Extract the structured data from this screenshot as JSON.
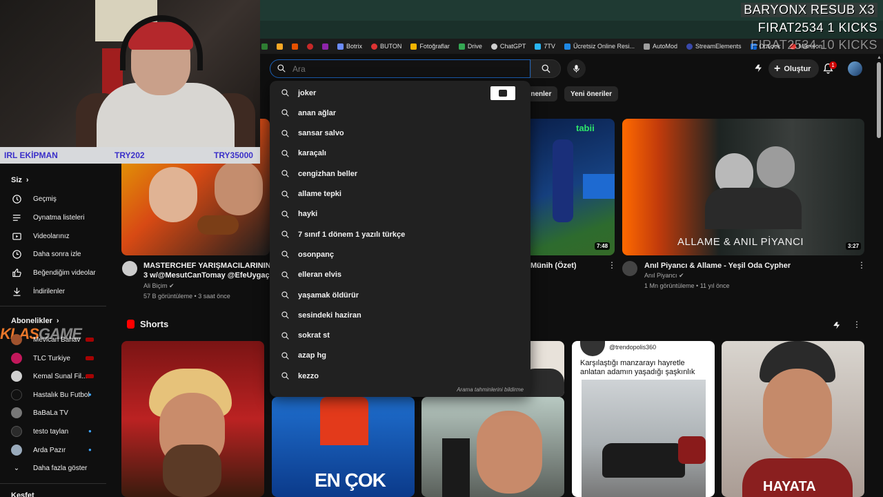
{
  "overlay": {
    "line1": "BARYONX  RESUB X3",
    "line2": "FIRAT2534  1 KICKS",
    "line3": "FIRAT2534  10 KICKS",
    "irl_bar": {
      "left": "IRL EKİPMAN",
      "mid": "TRY202",
      "right": "TRY35000"
    },
    "logo_text": "KLAS",
    "logo_text2": "GAME"
  },
  "bookmarks": [
    {
      "label": "Botrix",
      "color": "#6b8cff"
    },
    {
      "label": "BUTON",
      "color": "#d33"
    },
    {
      "label": "Fotoğraflar",
      "color": "#f4b400"
    },
    {
      "label": "Drive",
      "color": "#34a853"
    },
    {
      "label": "ChatGPT",
      "color": "#cfcfcf"
    },
    {
      "label": "7TV",
      "color": "#29b6f6"
    },
    {
      "label": "Ücretsiz Online Resi...",
      "color": "#1e88e5"
    },
    {
      "label": "AutoMod",
      "color": "#9e9e9e"
    },
    {
      "label": "StreamElements",
      "color": "#3949ab"
    },
    {
      "label": "Outlook",
      "color": "#0a64d6"
    },
    {
      "label": "Mikrofon",
      "color": "#e53935"
    }
  ],
  "search": {
    "placeholder": "Ara",
    "value": ""
  },
  "header": {
    "create_label": "Oluştur",
    "notif_count": "1"
  },
  "chips": [
    "lenenler",
    "Yeni öneriler"
  ],
  "sidebar": {
    "you_label": "Siz",
    "items": [
      {
        "label": "Geçmiş",
        "icon": "history-icon"
      },
      {
        "label": "Oynatma listeleri",
        "icon": "playlist-icon"
      },
      {
        "label": "Videolarınız",
        "icon": "your-videos-icon"
      },
      {
        "label": "Daha sonra izle",
        "icon": "watch-later-icon"
      },
      {
        "label": "Beğendiğim videolar",
        "icon": "like-icon"
      },
      {
        "label": "İndirilenler",
        "icon": "download-icon"
      }
    ],
    "subs_title": "Abonelikler",
    "subs": [
      {
        "label": "Mevlcan Bahav",
        "color": "#a0522d",
        "badge": "live"
      },
      {
        "label": "TLC Turkiye",
        "color": "#c2185b",
        "badge": "live"
      },
      {
        "label": "Kemal Sunal Fil...",
        "color": "#d0d0d0",
        "badge": "live"
      },
      {
        "label": "Hastalık Bu Futbol",
        "color": "#111",
        "badge": "dot"
      },
      {
        "label": "BaBaLa TV",
        "color": "#777",
        "badge": ""
      },
      {
        "label": "testo taylan",
        "color": "#2b2b2b",
        "badge": "dot"
      },
      {
        "label": "Arda Pazır",
        "color": "#9ab",
        "badge": "dot"
      }
    ],
    "show_more": "Daha fazla göster",
    "keşfet": "Keşfet"
  },
  "videos": [
    {
      "title1": "MASTERCHEF YARIŞMACILARININ RE",
      "title2": "3 w/@MesutCanTomay @EfeUygaçYou",
      "channel": "Ali Biçim",
      "meta": "57 B görüntüleme • 3 saat önce"
    },
    {
      "title1": "Münih (Özet)",
      "channel": "",
      "meta": "",
      "duration": "7:48",
      "badge": "tabii"
    },
    {
      "title1": "Anıl Piyancı & Allame - Yeşil Oda Cypher",
      "channel": "Anıl Piyancı",
      "meta": "1 Mn görüntüleme • 11 yıl önce",
      "duration": "3:27",
      "thumb_text": "ALLAME & ANIL PİYANCI"
    }
  ],
  "shorts": {
    "title": "Shorts",
    "card3_handle": "@trendopolis360",
    "card3_caption": "Karşılaştığı manzarayı hayretle anlatan adamın yaşadığı şaşkınlık",
    "card2_caption": "EN ÇOK",
    "card4_caption": "HAYATA"
  },
  "suggestions": [
    "joker",
    "anan ağlar",
    "sansar salvo",
    "karaçalı",
    "cengizhan beller",
    "allame tepki",
    "hayki",
    "7 sınıf 1 dönem 1 yazılı türkçe",
    "osonpanç",
    "elleran elvis",
    "yaşamak öldürür",
    "sesindeki haziran",
    "sokrat st",
    "azap hg",
    "kezzo"
  ],
  "report_label": "Arama tahminlerini bildirme"
}
